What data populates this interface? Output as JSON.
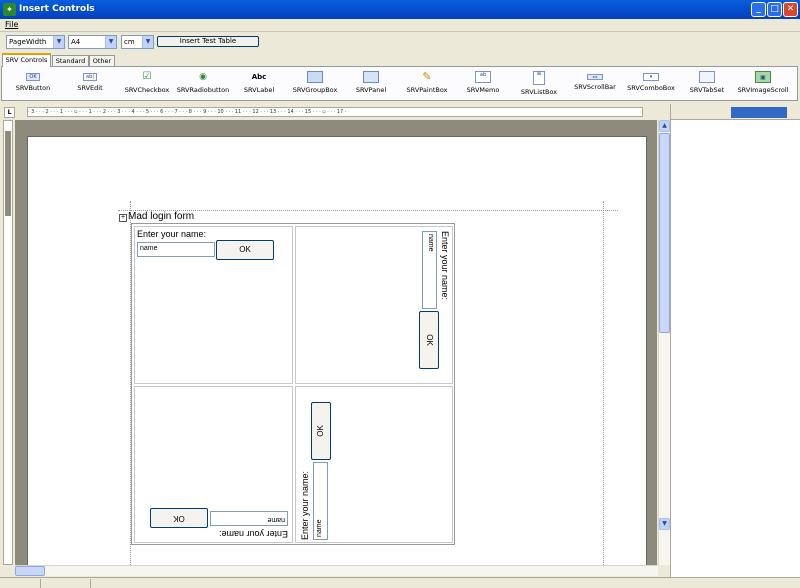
{
  "window": {
    "title": "Insert Controls"
  },
  "menu": {
    "file": "File"
  },
  "toolbar": {
    "zoom_value": "PageWidth",
    "paper_value": "A4",
    "units_value": "cm",
    "insert_table_button": "Insert Test Table"
  },
  "tabs": [
    {
      "label": "SRV Controls",
      "active": true
    },
    {
      "label": "Standard",
      "active": false
    },
    {
      "label": "Other",
      "active": false
    }
  ],
  "palette": [
    {
      "label": "SRVButton",
      "icon": "button-icon"
    },
    {
      "label": "SRVEdit",
      "icon": "edit-icon"
    },
    {
      "label": "SRVCheckbox",
      "icon": "checkbox-icon"
    },
    {
      "label": "SRVRadiobutton",
      "icon": "radio-icon"
    },
    {
      "label": "SRVLabel",
      "icon": "label-icon"
    },
    {
      "label": "SRVGroupBox",
      "icon": "groupbox-icon"
    },
    {
      "label": "SRVPanel",
      "icon": "panel-icon"
    },
    {
      "label": "SRVPaintBox",
      "icon": "paintbox-icon"
    },
    {
      "label": "SRVMemo",
      "icon": "memo-icon"
    },
    {
      "label": "SRVListBox",
      "icon": "listbox-icon"
    },
    {
      "label": "SRVScrollBar",
      "icon": "scrollbar-icon"
    },
    {
      "label": "SRVComboBox",
      "icon": "combobox-icon"
    },
    {
      "label": "SRVTabSet",
      "icon": "tabset-icon"
    },
    {
      "label": "SRVImageScroll",
      "icon": "imagescroll-icon"
    }
  ],
  "ruler": {
    "corner": "L",
    "h_marks": "· 3 · · · 2 · · · 1 · · · ▫ · · · 1 · · · 2 · · · 3 · · · 4 · · · 5 · · · 6 · · · 7 · · · 8 · · · 9 · · · 10 · · · 11 · · · 12 · · · 13 · · · 14 · · · 15 · · · ▫ · · · 17 ·"
  },
  "document": {
    "form_title": "Mad login form",
    "expand_glyph": "+",
    "prompt": "Enter your name:",
    "edit_value": "name",
    "ok_label": "OK"
  },
  "colors": {
    "titlebar": "#0551d4",
    "selection": "#316ac5",
    "canvas": "#8f8b7c"
  }
}
